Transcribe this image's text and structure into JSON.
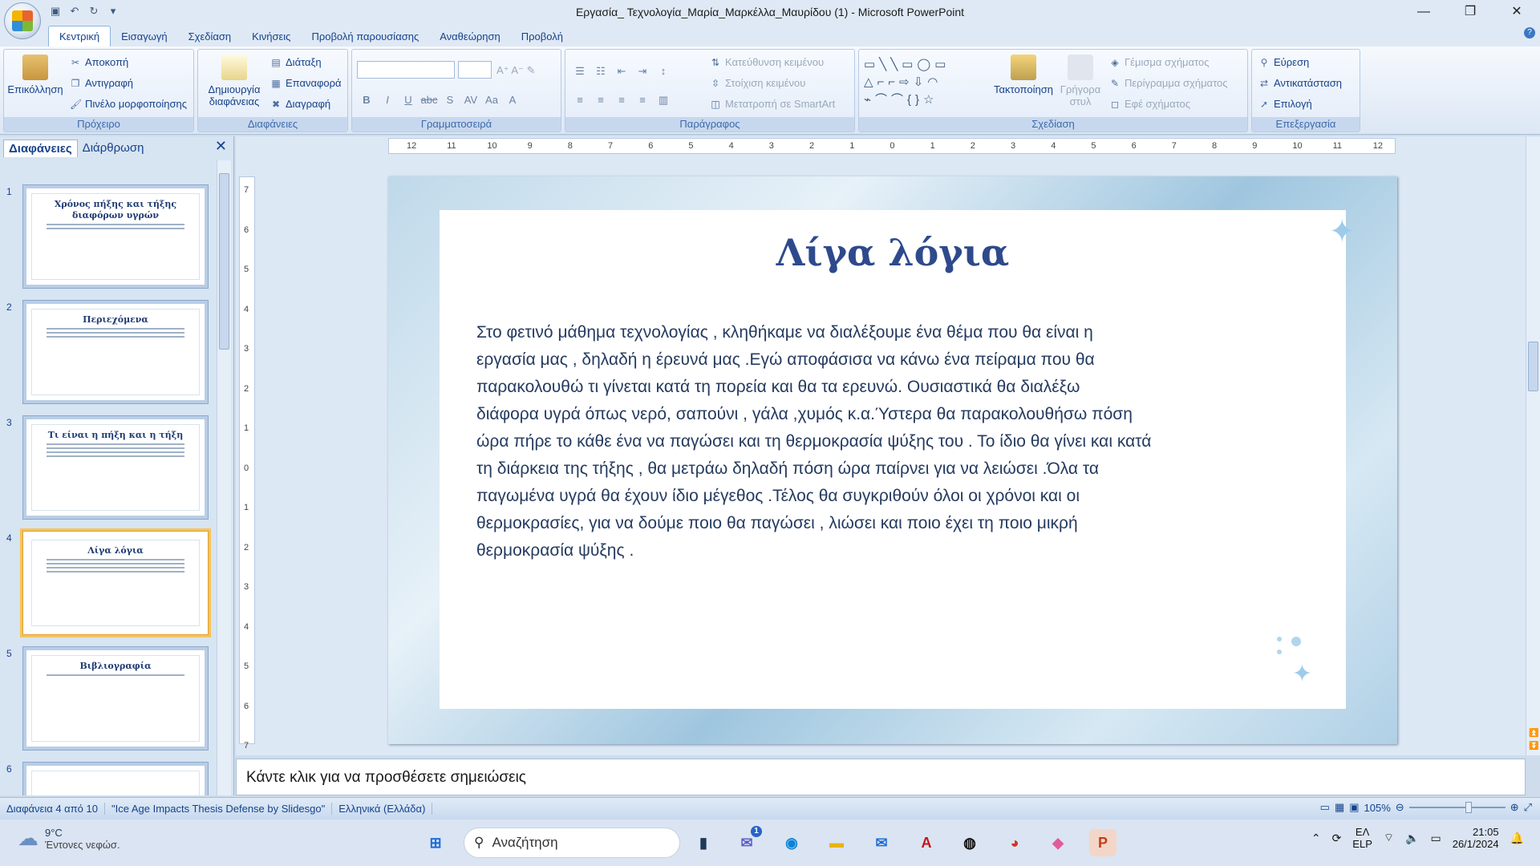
{
  "window": {
    "title": "Εργασία_ Τεχνολογία_Μαρία_Μαρκέλλα_Μαυρίδου (1) - Microsoft PowerPoint"
  },
  "tabs": [
    "Κεντρική",
    "Εισαγωγή",
    "Σχεδίαση",
    "Κινήσεις",
    "Προβολή παρουσίασης",
    "Αναθεώρηση",
    "Προβολή"
  ],
  "ribbon": {
    "clipboard": {
      "label": "Πρόχειρο",
      "paste": "Επικόλληση",
      "cut": "Αποκοπή",
      "copy": "Αντιγραφή",
      "painter": "Πινέλο μορφοποίησης"
    },
    "slides": {
      "label": "Διαφάνειες",
      "new_slide": "Δημιουργία διαφάνειας",
      "layout": "Διάταξη",
      "reset": "Επαναφορά",
      "delete": "Διαγραφή"
    },
    "font": {
      "label": "Γραμματοσειρά"
    },
    "paragraph": {
      "label": "Παράγραφος",
      "direction": "Κατεύθυνση κειμένου",
      "align": "Στοίχιση κειμένου",
      "smartart": "Μετατροπή σε SmartArt"
    },
    "drawing": {
      "label": "Σχεδίαση",
      "arrange": "Τακτοποίηση",
      "quick_styles": "Γρήγορα στυλ",
      "fill": "Γέμισμα σχήματος",
      "outline": "Περίγραμμα σχήματος",
      "effects": "Εφέ σχήματος"
    },
    "editing": {
      "label": "Επεξεργασία",
      "find": "Εύρεση",
      "replace": "Αντικατάσταση",
      "select": "Επιλογή"
    }
  },
  "pane": {
    "tab_slides": "Διαφάνειες",
    "tab_outline": "Διάρθρωση"
  },
  "thumbnails": [
    {
      "n": "1",
      "title": "Χρόνος πήξης και τήξης διαφόρων υγρών"
    },
    {
      "n": "2",
      "title": "Περιεχόμενα"
    },
    {
      "n": "3",
      "title": "Τι είναι η πήξη και η τήξη"
    },
    {
      "n": "4",
      "title": "Λίγα λόγια"
    },
    {
      "n": "5",
      "title": "Βιβλιογραφία"
    },
    {
      "n": "6",
      "title": ""
    }
  ],
  "ruler_h": [
    "12",
    "11",
    "10",
    "9",
    "8",
    "7",
    "6",
    "5",
    "4",
    "3",
    "2",
    "1",
    "0",
    "1",
    "2",
    "3",
    "4",
    "5",
    "6",
    "7",
    "8",
    "9",
    "10",
    "11",
    "12"
  ],
  "ruler_v": [
    "7",
    "6",
    "5",
    "4",
    "3",
    "2",
    "1",
    "0",
    "1",
    "2",
    "3",
    "4",
    "5",
    "6",
    "7"
  ],
  "slide": {
    "title": "Λίγα λόγια",
    "lines": [
      "Στο φετινό μάθημα τεχνολογίας , κληθήκαμε να διαλέξουμε ένα θέμα που θα είναι η",
      "εργασία μας , δηλαδή η έρευνά μας .Εγώ αποφάσισα να κάνω ένα πείραμα που θα",
      "παρακολουθώ τι γίνεται κατά τη πορεία και θα τα ερευνώ. Ουσιαστικά θα διαλέξω",
      "διάφορα υγρά όπως νερό, σαπούνι , γάλα   ,χυμός κ.α.Ύστερα θα παρακολουθήσω πόση",
      "ώρα πήρε το κάθε ένα να παγώσει και τη θερμοκρασία ψύξης του . Το ίδιο θα γίνει και κατά",
      "τη διάρκεια της τήξης , θα μετράω δηλαδή πόση ώρα παίρνει για να λειώσει .Όλα τα",
      "παγωμένα υγρά θα έχουν ίδιο μέγεθος .Τέλος θα συγκριθούν όλοι οι χρόνοι και οι",
      "θερμοκρασίες, για να δούμε ποιο θα παγώσει , λιώσει και ποιο έχει τη ποιο μικρή",
      "θερμοκρασία ψύξης ."
    ]
  },
  "notes": {
    "placeholder": "Κάντε κλικ για να προσθέσετε σημειώσεις"
  },
  "status": {
    "slide_of": "Διαφάνεια 4 από 10",
    "theme": "\"Ice Age Impacts Thesis Defense by Slidesgo\"",
    "language": "Ελληνικά (Ελλάδα)",
    "zoom": "105%"
  },
  "taskbar": {
    "temp": "9°C",
    "weather": "Έντονες νεφώσ.",
    "search": "Αναζήτηση",
    "lang1": "ΕΛ",
    "lang2": "ELP",
    "time": "21:05",
    "date": "26/1/2024",
    "badge": "1"
  }
}
